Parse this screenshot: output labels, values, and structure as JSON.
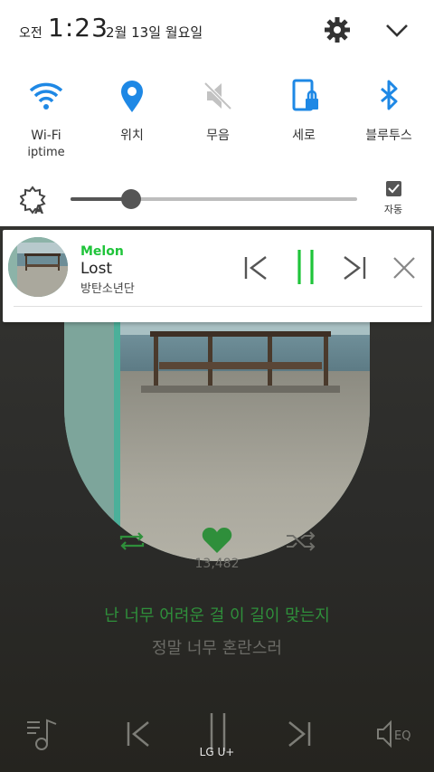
{
  "status_bar": {
    "ampm": "오전",
    "time": "1:23",
    "date": "2월 13일 월요일"
  },
  "quick_settings": {
    "tiles": [
      {
        "label": "Wi-Fi",
        "sub": "iptime",
        "icon": "wifi-icon",
        "active": true
      },
      {
        "label": "위치",
        "sub": "",
        "icon": "location-icon",
        "active": true
      },
      {
        "label": "무음",
        "sub": "",
        "icon": "mute-icon",
        "active": false
      },
      {
        "label": "세로",
        "sub": "",
        "icon": "portrait-lock-icon",
        "active": true
      },
      {
        "label": "블루투스",
        "sub": "",
        "icon": "bluetooth-icon",
        "active": true
      }
    ],
    "brightness_level": 0.21,
    "auto_label": "자동",
    "auto_checked": true
  },
  "media_notification": {
    "app": "Melon",
    "title": "Lost",
    "artist": "방탄소년단"
  },
  "player": {
    "like_count": "13,482",
    "lyric_current": "난 너무 어려운 걸 이 길이 맞는지",
    "lyric_next": "정말 너무 혼란스러",
    "carrier": "LG U+"
  },
  "colors": {
    "accent_blue": "#1e88e5",
    "melon_green": "#1fc43a",
    "player_green": "#2f8f3b",
    "inactive_gray": "#9e9e9e"
  }
}
